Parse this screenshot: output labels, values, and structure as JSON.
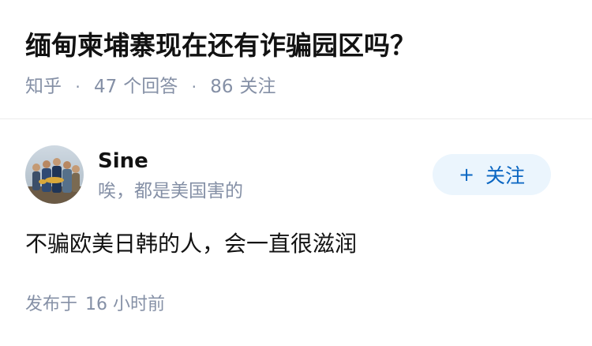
{
  "question": {
    "title": "缅甸柬埔寨现在还有诈骗园区吗？",
    "meta": {
      "source": "知乎",
      "separator": "·",
      "answer_count": "47",
      "answer_label": "个回答",
      "follower_count": "86",
      "follower_label": "关注"
    }
  },
  "answer": {
    "author": {
      "name": "Sine",
      "bio": "唉，都是美国害的",
      "avatar_icon": "group-photo-avatar"
    },
    "follow_button": {
      "icon": "plus-icon",
      "plus": "+",
      "label": "关注"
    },
    "content": "不骗欧美日韩的人，会一直很滋润",
    "publish": {
      "label": "发布于",
      "time": "16 小时前"
    }
  },
  "colors": {
    "title": "#121212",
    "meta": "#8590a6",
    "accent": "#0a66c2",
    "button_bg": "#ebf5fd",
    "divider": "#ebebeb"
  }
}
